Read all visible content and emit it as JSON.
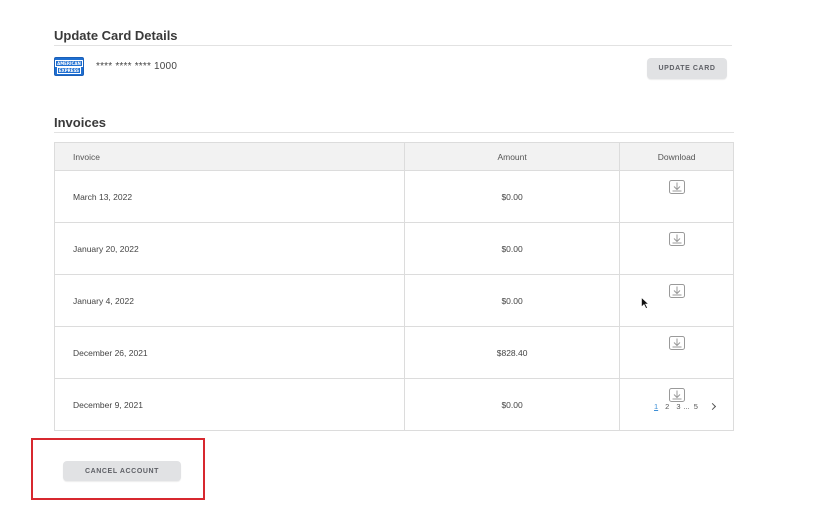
{
  "card_section": {
    "title": "Update Card Details",
    "card_brand_line1": "AMERICAN",
    "card_brand_line2": "EXPRESS",
    "card_number": "**** **** **** 1000",
    "update_button_label": "UPDATE CARD"
  },
  "invoices_section": {
    "title": "Invoices",
    "columns": {
      "invoice": "Invoice",
      "amount": "Amount",
      "download": "Download"
    },
    "rows": [
      {
        "date": "March 13, 2022",
        "amount": "$0.00"
      },
      {
        "date": "January 20, 2022",
        "amount": "$0.00"
      },
      {
        "date": "January 4, 2022",
        "amount": "$0.00"
      },
      {
        "date": "December 26, 2021",
        "amount": "$828.40"
      },
      {
        "date": "December 9, 2021",
        "amount": "$0.00"
      }
    ]
  },
  "pagination": {
    "current": "1",
    "p2": "2",
    "p3": "3",
    "ellipsis": "...",
    "last": "5"
  },
  "account": {
    "cancel_button_label": "CANCEL ACCOUNT"
  },
  "colors": {
    "highlight": "#d7282f",
    "amex_blue": "#1f6fd1",
    "current_page": "#3d8fd6"
  },
  "icons": {
    "download": "download-tray-icon",
    "next": "chevron-right-icon",
    "pointer": "mouse-cursor-icon"
  }
}
